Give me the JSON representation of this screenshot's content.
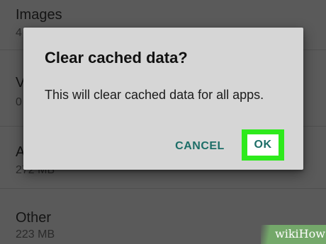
{
  "background_list": {
    "items": [
      {
        "title": "Images",
        "subtitle": "4"
      },
      {
        "title": "V",
        "subtitle": "0"
      },
      {
        "title": "A",
        "subtitle": "272 MB"
      },
      {
        "title": "Other",
        "subtitle": "223 MB"
      }
    ]
  },
  "dialog": {
    "title": "Clear cached data?",
    "message": "This will clear cached data for all apps.",
    "cancel_label": "CANCEL",
    "ok_label": "OK"
  },
  "watermark": {
    "text": "wikiHow"
  },
  "colors": {
    "overlay_background": "#5a5a5a",
    "dialog_background": "#d6d6d6",
    "button_text": "#1d6e68",
    "highlight": "#2eea1c",
    "watermark_green": "#74a86a"
  }
}
